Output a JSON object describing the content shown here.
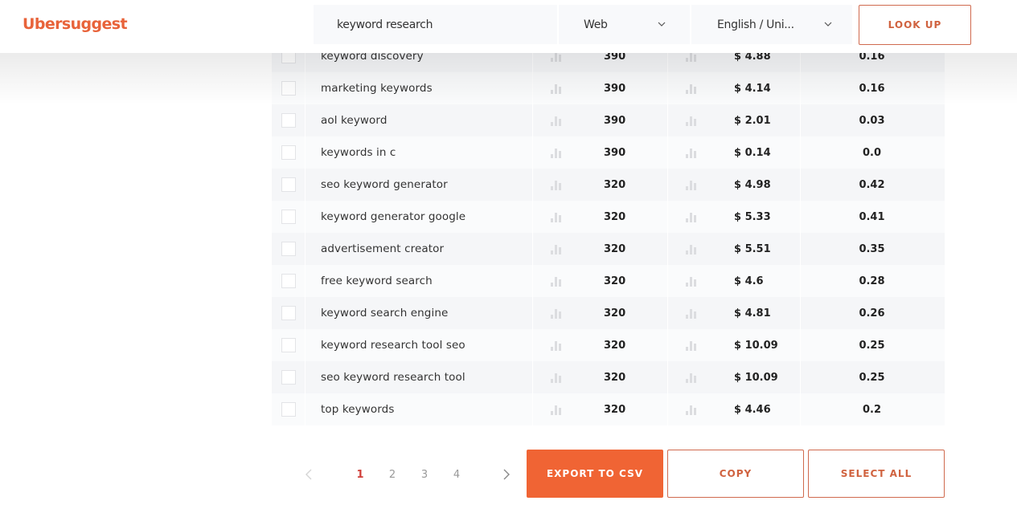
{
  "header": {
    "logo": "Ubersuggest",
    "search_value": "keyword research",
    "platform_select": "Web",
    "language_select": "English / Uni...",
    "lookup_label": "LOOK UP"
  },
  "colors": {
    "brand": "#e8633a",
    "export_button": "#f06434"
  },
  "table": {
    "rows": [
      {
        "keyword": "keyword discovery",
        "volume": "390",
        "cpc": "$ 4.88",
        "competition": "0.16"
      },
      {
        "keyword": "marketing keywords",
        "volume": "390",
        "cpc": "$ 4.14",
        "competition": "0.16"
      },
      {
        "keyword": "aol keyword",
        "volume": "390",
        "cpc": "$ 2.01",
        "competition": "0.03"
      },
      {
        "keyword": "keywords in c",
        "volume": "390",
        "cpc": "$ 0.14",
        "competition": "0.0"
      },
      {
        "keyword": "seo keyword generator",
        "volume": "320",
        "cpc": "$ 4.98",
        "competition": "0.42"
      },
      {
        "keyword": "keyword generator google",
        "volume": "320",
        "cpc": "$ 5.33",
        "competition": "0.41"
      },
      {
        "keyword": "advertisement creator",
        "volume": "320",
        "cpc": "$ 5.51",
        "competition": "0.35"
      },
      {
        "keyword": "free keyword search",
        "volume": "320",
        "cpc": "$ 4.6",
        "competition": "0.28"
      },
      {
        "keyword": "keyword search engine",
        "volume": "320",
        "cpc": "$ 4.81",
        "competition": "0.26"
      },
      {
        "keyword": "keyword research tool seo",
        "volume": "320",
        "cpc": "$ 10.09",
        "competition": "0.25"
      },
      {
        "keyword": "seo keyword research tool",
        "volume": "320",
        "cpc": "$ 10.09",
        "competition": "0.25"
      },
      {
        "keyword": "top keywords",
        "volume": "320",
        "cpc": "$ 4.46",
        "competition": "0.2"
      }
    ]
  },
  "pagination": {
    "pages": [
      "1",
      "2",
      "3",
      "4"
    ],
    "current": "1",
    "prev_icon": "chevron-left-icon",
    "next_icon": "chevron-right-icon"
  },
  "actions": {
    "export_label": "EXPORT TO CSV",
    "copy_label": "COPY",
    "select_all_label": "SELECT ALL"
  }
}
